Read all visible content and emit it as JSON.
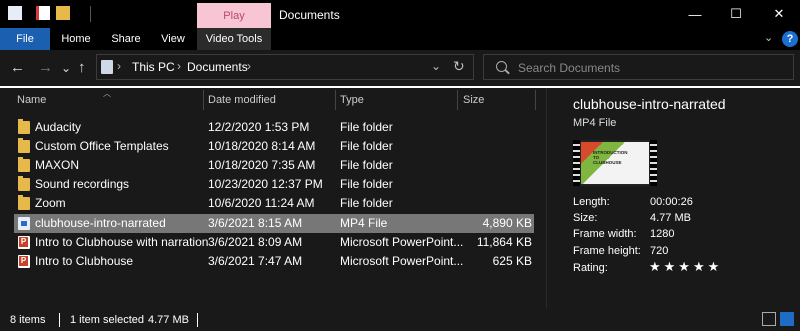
{
  "window": {
    "title": "Documents",
    "context_tab": "Play",
    "controls": {
      "minimize": "—",
      "maximize": "☐",
      "close": "✕"
    }
  },
  "ribbon": {
    "tabs": [
      "File",
      "Home",
      "Share",
      "View",
      "Video Tools"
    ],
    "collapse": "⌄",
    "help": "?"
  },
  "nav": {
    "back": "←",
    "forward": "→",
    "recent": "⌄",
    "up": "↑",
    "breadcrumb": [
      "This PC",
      "Documents"
    ],
    "separator": "›",
    "dropdown": "⌄",
    "refresh": "↻"
  },
  "search": {
    "placeholder": "Search Documents"
  },
  "columns": {
    "name": "Name",
    "date": "Date modified",
    "type": "Type",
    "size": "Size"
  },
  "files": [
    {
      "name": "Audacity",
      "date": "12/2/2020 1:53 PM",
      "type": "File folder",
      "size": "",
      "icon": "folder-icon"
    },
    {
      "name": "Custom Office Templates",
      "date": "10/18/2020 8:14 AM",
      "type": "File folder",
      "size": "",
      "icon": "folder-icon"
    },
    {
      "name": "MAXON",
      "date": "10/18/2020 7:35 AM",
      "type": "File folder",
      "size": "",
      "icon": "folder-icon"
    },
    {
      "name": "Sound recordings",
      "date": "10/23/2020 12:37 PM",
      "type": "File folder",
      "size": "",
      "icon": "folder-icon"
    },
    {
      "name": "Zoom",
      "date": "10/6/2020 11:24 AM",
      "type": "File folder",
      "size": "",
      "icon": "folder-icon"
    },
    {
      "name": "clubhouse-intro-narrated",
      "date": "3/6/2021 8:15 AM",
      "type": "MP4 File",
      "size": "4,890 KB",
      "icon": "video-file-icon"
    },
    {
      "name": "Intro to Clubhouse with narration",
      "date": "3/6/2021 8:09 AM",
      "type": "Microsoft PowerPoint...",
      "size": "11,864 KB",
      "icon": "powerpoint-file-icon"
    },
    {
      "name": "Intro to Clubhouse",
      "date": "3/6/2021 7:47 AM",
      "type": "Microsoft PowerPoint...",
      "size": "625 KB",
      "icon": "powerpoint-file-icon"
    }
  ],
  "preview": {
    "title": "clubhouse-intro-narrated",
    "type": "MP4 File",
    "thumbnail_text": "INTRODUCTION TO CLUBHOUSE",
    "properties": [
      {
        "label": "Length:",
        "value": "00:00:26"
      },
      {
        "label": "Size:",
        "value": "4.77 MB"
      },
      {
        "label": "Frame width:",
        "value": "1280"
      },
      {
        "label": "Frame height:",
        "value": "720"
      },
      {
        "label": "Rating:",
        "value": ""
      }
    ],
    "rating_stars": "★★★★★",
    "rating_value": 0
  },
  "status": {
    "count": "8 items",
    "selected": "1 item selected",
    "size": "4.77 MB"
  },
  "colors": {
    "accent": "#1b5fb0",
    "context_tab_bg": "#f8c5d4",
    "selection": "#777777",
    "folder": "#e6b94a"
  }
}
